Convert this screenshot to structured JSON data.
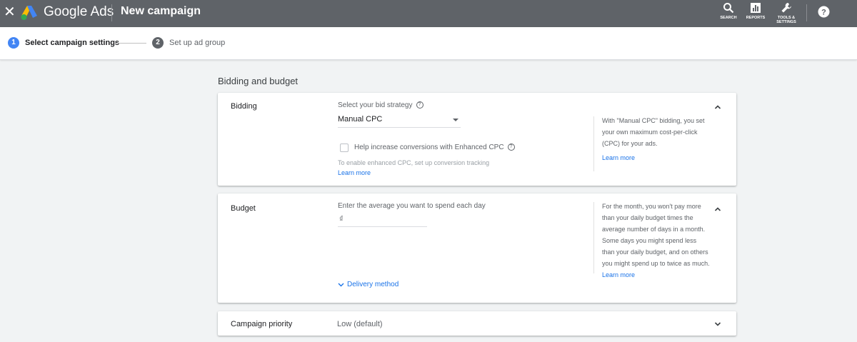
{
  "topbar": {
    "brand": "Google Ads",
    "page_title": "New campaign",
    "tools": {
      "search_label": "SEARCH",
      "reports_label": "REPORTS",
      "tools_label_line1": "TOOLS &",
      "tools_label_line2": "SETTINGS"
    },
    "icons": [
      "close-icon",
      "google-ads-logo",
      "search-icon",
      "reports-icon",
      "wrench-icon",
      "help-icon"
    ]
  },
  "stepper": {
    "steps": [
      {
        "number": "1",
        "label": "Select campaign settings",
        "active": true
      },
      {
        "number": "2",
        "label": "Set up ad group",
        "active": false
      }
    ]
  },
  "section": {
    "title": "Bidding and budget"
  },
  "bidding": {
    "title": "Bidding",
    "strategy_label": "Select your bid strategy",
    "strategy_value": "Manual CPC",
    "enhanced_label": "Help increase conversions with Enhanced CPC",
    "enhanced_checked": false,
    "hint": "To enable enhanced CPC, set up conversion tracking",
    "learn_more": "Learn more",
    "side_text": "With \"Manual CPC\" bidding, you set your own maximum cost-per-click (CPC) for your ads.",
    "side_link": "Learn more"
  },
  "budget": {
    "title": "Budget",
    "input_label": "Enter the average you want to spend each day",
    "currency_symbol": "₫",
    "side_text": "For the month, you won't pay more than your daily budget times the average number of days in a month. Some days you might spend less than your daily budget, and on others you might spend up to twice as much.",
    "side_link": "Learn more",
    "delivery_label": "Delivery method"
  },
  "priority": {
    "title": "Campaign priority",
    "value": "Low (default)"
  },
  "colors": {
    "topbar": "#5f6368",
    "accent": "#4285f4",
    "link": "#1a73e8",
    "background": "#f1f3f4"
  }
}
